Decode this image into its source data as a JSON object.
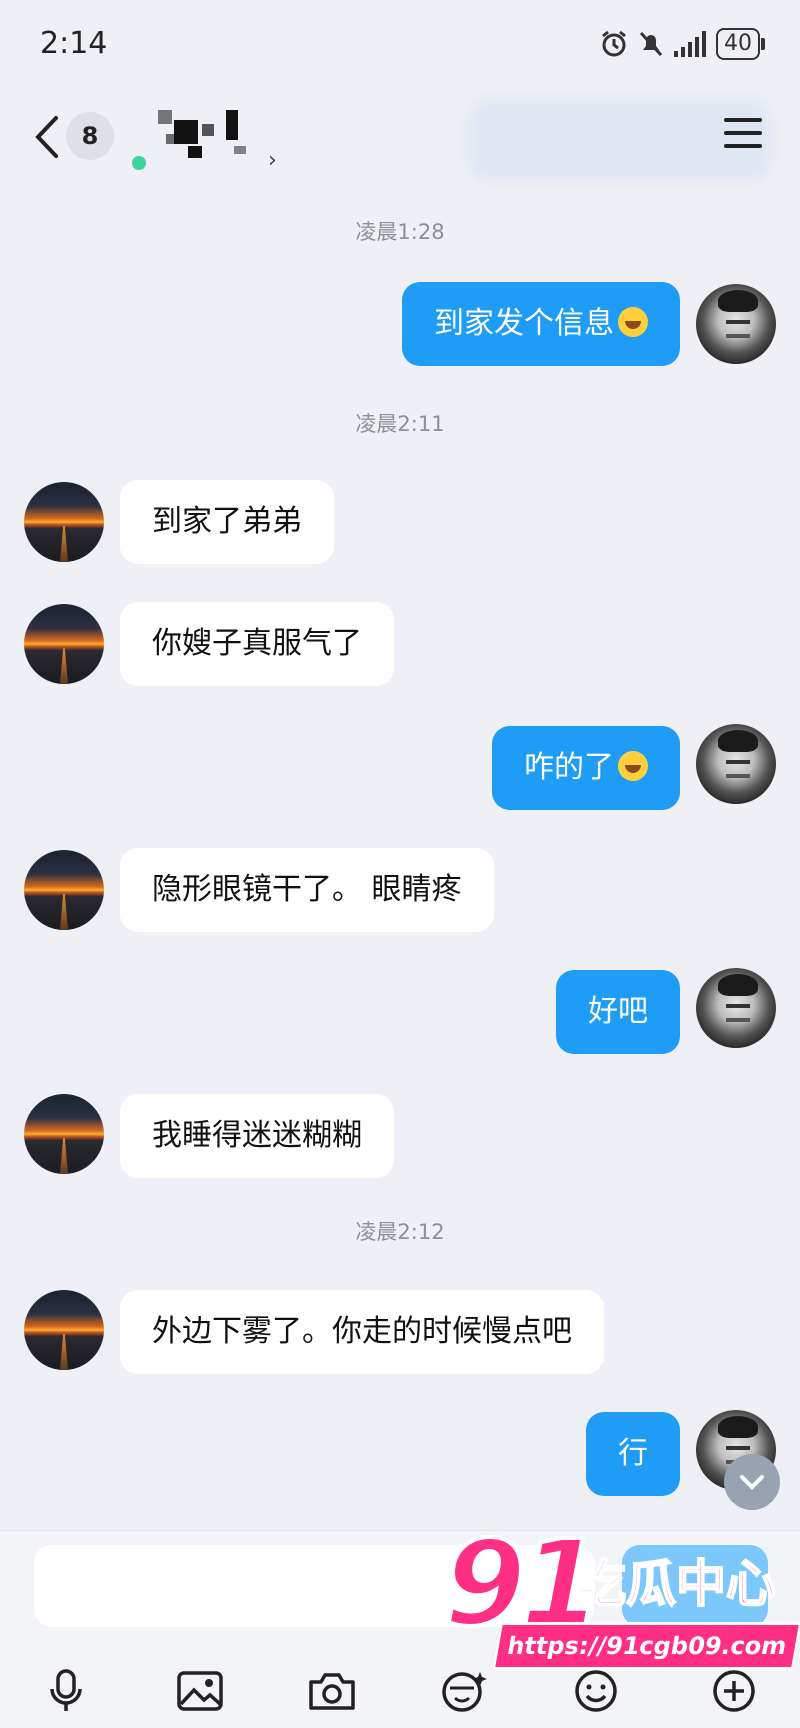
{
  "status_bar": {
    "time": "2:14",
    "battery": "40",
    "icons": [
      "alarm-icon",
      "mute-icon",
      "signal-icon",
      "battery-icon"
    ]
  },
  "header": {
    "back_icon": "chevron-left-icon",
    "unread_count": "8",
    "contact_name": "(pixelated)",
    "menu_icon": "hamburger-icon"
  },
  "chat": {
    "timestamps": [
      "凌晨1:28",
      "凌晨2:11",
      "凌晨2:12"
    ],
    "messages": [
      {
        "side": "right",
        "text": "到家发个信息",
        "emoji": "laughing-tears-emoji"
      },
      {
        "side": "left",
        "text": "到家了弟弟"
      },
      {
        "side": "left",
        "text": "你嫂子真服气了"
      },
      {
        "side": "right",
        "text": "咋的了",
        "emoji": "laughing-tears-emoji"
      },
      {
        "side": "left",
        "text": "隐形眼镜干了。 眼睛疼"
      },
      {
        "side": "right",
        "text": "好吧"
      },
      {
        "side": "left",
        "text": "我睡得迷迷糊糊"
      },
      {
        "side": "left",
        "text": "外边下雾了。你走的时候慢点吧"
      },
      {
        "side": "right",
        "text": "行"
      }
    ],
    "colors": {
      "outgoing_bubble": "#1e9cf6",
      "incoming_bubble": "#ffffff",
      "background": "#eef0f5"
    }
  },
  "input": {
    "placeholder": "",
    "tools": [
      "microphone-icon",
      "image-icon",
      "camera-icon",
      "sticker-icon",
      "emoji-icon",
      "plus-icon"
    ]
  },
  "watermark": {
    "logo": "91",
    "title": "吃瓜中心",
    "url": "https://91cgb09.com"
  }
}
